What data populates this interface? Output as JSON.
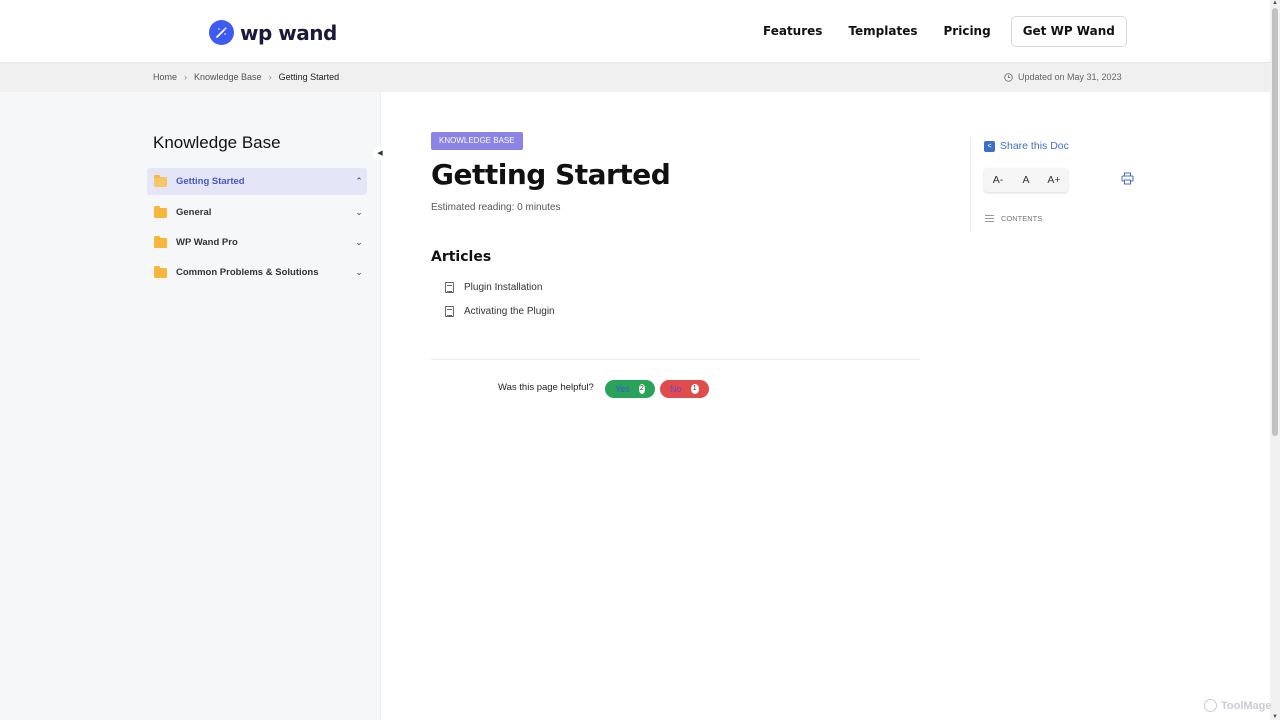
{
  "brand": {
    "name": "wp wand",
    "accent": "#3d5af1"
  },
  "nav": {
    "features": "Features",
    "templates": "Templates",
    "pricing": "Pricing",
    "cta": "Get WP Wand"
  },
  "breadcrumb": {
    "home": "Home",
    "kb": "Knowledge Base",
    "current": "Getting Started"
  },
  "updated": "Updated on May 31, 2023",
  "sidebar": {
    "title": "Knowledge Base",
    "items": [
      {
        "label": "Getting Started",
        "active": true,
        "chevron": "chevron-up-icon"
      },
      {
        "label": "General",
        "active": false,
        "chevron": "chevron-down-icon"
      },
      {
        "label": "WP Wand Pro",
        "active": false,
        "chevron": "chevron-down-icon"
      },
      {
        "label": "Common Problems & Solutions",
        "active": false,
        "chevron": "chevron-down-icon"
      }
    ]
  },
  "doc": {
    "badge": "KNOWLEDGE BASE",
    "title": "Getting Started",
    "reading": "Estimated reading: 0 minutes",
    "articles_heading": "Articles",
    "articles": [
      "Plugin Installation",
      "Activating the Plugin"
    ]
  },
  "feedback": {
    "question": "Was this page helpful?",
    "yes_label": "Yes",
    "yes_count": "2",
    "no_label": "No",
    "no_count": "1"
  },
  "rpanel": {
    "share": "Share this Doc",
    "font_decrease": "A-",
    "font_reset": "A",
    "font_increase": "A+",
    "contents": "CONTENTS"
  },
  "watermark": "ToolMage"
}
